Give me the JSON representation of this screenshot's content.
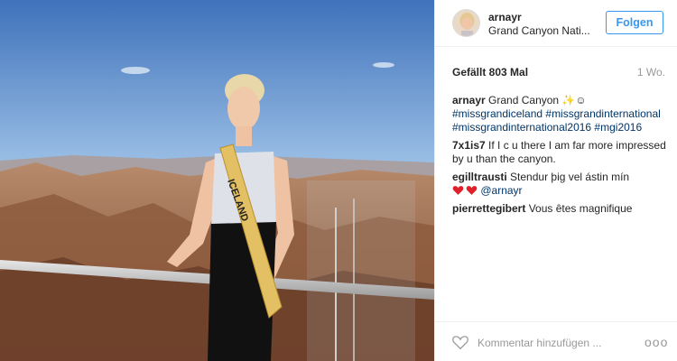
{
  "post": {
    "username": "arnayr",
    "location": "Grand Canyon Nati...",
    "follow_label": "Folgen",
    "likes": "Gefällt 803 Mal",
    "time": "1 Wo.",
    "caption_text": "Grand Canyon ✨☺",
    "caption_tags": "#missgrandiceland #missgrandinternational #missgrandinternational2016 #mgi2016",
    "sash_text": "ICELAND"
  },
  "comments": [
    {
      "user": "7x1is7",
      "text": "If I c u there I am far more impressed by u than the canyon."
    },
    {
      "user": "egilltrausti",
      "text": "Stendur þig vel ástin mín"
    },
    {
      "user": "",
      "text": "@arnayr"
    },
    {
      "user": "pierrettegibert",
      "text": "Vous êtes magnifique"
    }
  ],
  "footer": {
    "comment_placeholder": "Kommentar hinzufügen ...",
    "more_label": "ooo"
  },
  "icons": [
    "heart-outline-icon",
    "more-options-icon",
    "heart-emoji-icon"
  ],
  "colors": {
    "accent": "#3897f0",
    "hashtag": "#003569",
    "heart_red": "#e0202a",
    "muted": "#999999"
  }
}
